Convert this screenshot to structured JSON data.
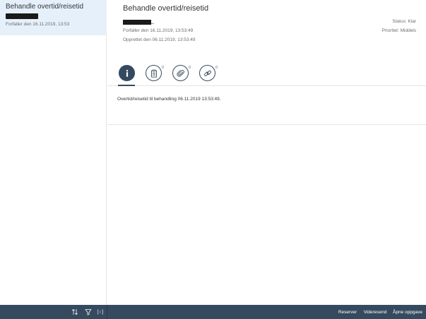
{
  "master": {
    "items": [
      {
        "title": "Behandle overtid/reisetid",
        "due": "Forfaller den 16.11.2019, 13:53"
      }
    ],
    "footer": {
      "sort_icon": "sort-icon",
      "filter_icon": "filter-icon",
      "group_icon": "group-icon"
    }
  },
  "detail": {
    "title": "Behandle overtid/reisetid",
    "due": "Forfaller den 16.11.2019, 13:53:49",
    "created": "Opprettet den 06.11.2019, 13:53:49",
    "status": "Status: Klar",
    "priority": "Prioritet: Middels",
    "tabs": [
      {
        "icon": "info-icon",
        "count": "",
        "selected": true
      },
      {
        "icon": "clipboard-icon",
        "count": "0",
        "selected": false
      },
      {
        "icon": "attachment-icon",
        "count": "0",
        "selected": false
      },
      {
        "icon": "link-icon",
        "count": "0",
        "selected": false
      }
    ],
    "description": "Overtid/reisetid til behandling 06.11.2019 13:53:49."
  },
  "footer": {
    "reserve": "Reserver",
    "forward": "Videresend",
    "open_task": "Åpne oppgave"
  },
  "colors": {
    "shell": "#354a5f",
    "selected_item": "#e5f0fa"
  }
}
